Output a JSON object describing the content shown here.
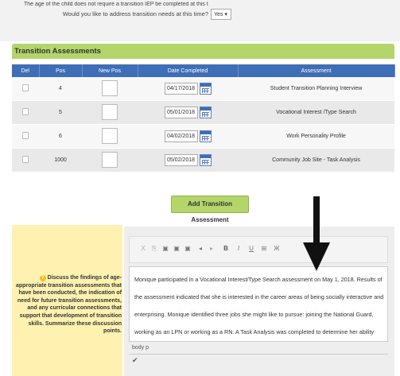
{
  "question": {
    "line1": "The age of the child does not require a transition IEP be completed at this time.",
    "line2": "Would you like to address transition needs at this time?",
    "answer": "Yes ▾"
  },
  "section": {
    "title": "Transition Assessments"
  },
  "table": {
    "headers": [
      "Del",
      "Pos",
      "New Pos",
      "Date Completed",
      "Assessment"
    ],
    "rows": [
      {
        "pos": "4",
        "date": "04/17/2018",
        "assessment": "Student Transition Planning Interview"
      },
      {
        "pos": "5",
        "date": "05/01/2018",
        "assessment": "Vocational Interest /Type Search"
      },
      {
        "pos": "6",
        "date": "04/02/2018",
        "assessment": "Work Personality Profile"
      },
      {
        "pos": "1000",
        "date": "05/02/2018",
        "assessment": "Community Job Site - Task Analysis"
      }
    ]
  },
  "add_button": "Add Transition Assessment",
  "hint": "Discuss the findings of age-appropriate transition assessments that have been conducted, the indication of need for future transition assessments, and any curricular connections that support that development of transition skills. Summarize these discussion points.",
  "editor": {
    "content": "Monique participated in a Vocational Interest/Type Search assessment on May 1, 2018.  Results of the assessment indicated that she is interested in the career areas of being socially interactive and enterprising.  Monique identified three jobs she might like to pursue:  joining the National Guard, working as an LPN or working as a RN. A Task Analysis was completed to determine her ability and needs at",
    "status": "body  p",
    "toolbar": [
      "X",
      "⎘",
      "▣",
      "▣",
      "▣",
      "◂",
      "▸",
      "B",
      "I",
      "U",
      "⊞",
      "Ж"
    ]
  }
}
